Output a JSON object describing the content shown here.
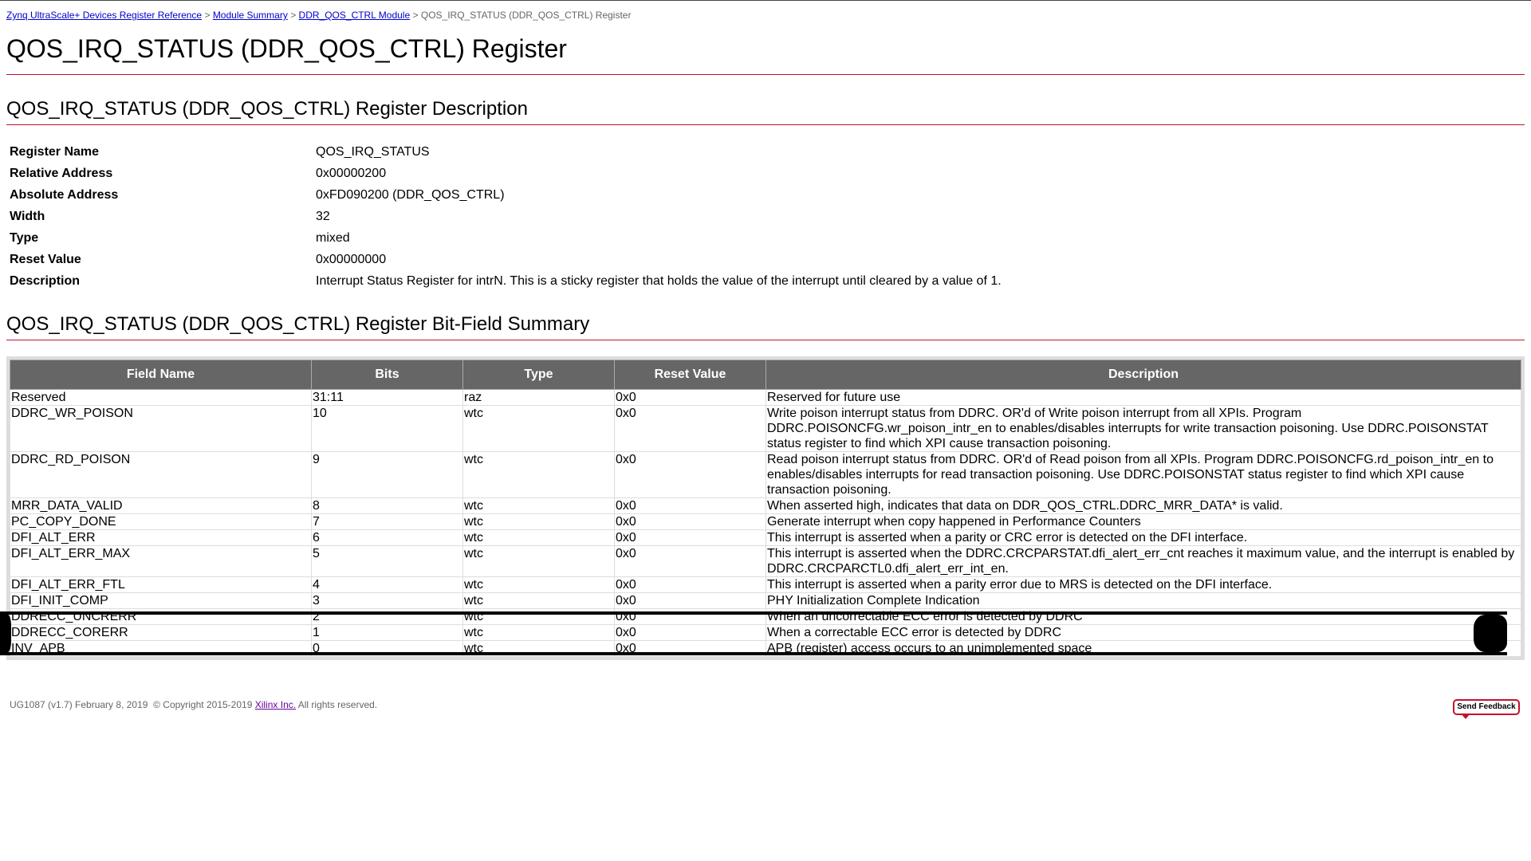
{
  "breadcrumb": {
    "items": [
      {
        "label": "Zynq UltraScale+ Devices Register Reference"
      },
      {
        "label": "Module Summary"
      },
      {
        "label": "DDR_QOS_CTRL Module"
      }
    ],
    "current": "QOS_IRQ_STATUS (DDR_QOS_CTRL) Register",
    "separator": ">"
  },
  "page_title": "QOS_IRQ_STATUS (DDR_QOS_CTRL) Register",
  "description_section": {
    "heading": "QOS_IRQ_STATUS (DDR_QOS_CTRL) Register Description",
    "rows": [
      {
        "key": "Register Name",
        "value": "QOS_IRQ_STATUS"
      },
      {
        "key": "Relative Address",
        "value": "0x00000200"
      },
      {
        "key": "Absolute Address",
        "value": "0xFD090200 (DDR_QOS_CTRL)"
      },
      {
        "key": "Width",
        "value": "32"
      },
      {
        "key": "Type",
        "value": "mixed"
      },
      {
        "key": "Reset Value",
        "value": "0x00000000"
      },
      {
        "key": "Description",
        "value": "Interrupt Status Register for intrN. This is a sticky register that holds the value of the interrupt until cleared by a value of 1."
      }
    ]
  },
  "bitfield_section": {
    "heading": "QOS_IRQ_STATUS (DDR_QOS_CTRL) Register Bit-Field Summary",
    "columns": [
      "Field Name",
      "Bits",
      "Type",
      "Reset Value",
      "Description"
    ],
    "rows": [
      {
        "name": "Reserved",
        "bits": "31:11",
        "type": "raz",
        "reset": "0x0",
        "desc": "Reserved for future use"
      },
      {
        "name": "DDRC_WR_POISON",
        "bits": "10",
        "type": "wtc",
        "reset": "0x0",
        "desc": "Write poison interrupt status from DDRC. OR'd of Write poison interrupt from all XPIs. Program DDRC.POISONCFG.wr_poison_intr_en to enables/disables interrupts for write transaction poisoning. Use DDRC.POISONSTAT status register to find which XPI cause transaction poisoning."
      },
      {
        "name": "DDRC_RD_POISON",
        "bits": "9",
        "type": "wtc",
        "reset": "0x0",
        "desc": "Read poison interrupt status from DDRC. OR'd of Read poison from all XPIs. Program DDRC.POISONCFG.rd_poison_intr_en to enables/disables interrupts for read transaction poisoning. Use DDRC.POISONSTAT status register to find which XPI cause transaction poisoning."
      },
      {
        "name": "MRR_DATA_VALID",
        "bits": "8",
        "type": "wtc",
        "reset": "0x0",
        "desc": "When asserted high, indicates that data on DDR_QOS_CTRL.DDRC_MRR_DATA* is valid."
      },
      {
        "name": "PC_COPY_DONE",
        "bits": "7",
        "type": "wtc",
        "reset": "0x0",
        "desc": "Generate interrupt when copy happened in Performance Counters"
      },
      {
        "name": "DFI_ALT_ERR",
        "bits": "6",
        "type": "wtc",
        "reset": "0x0",
        "desc": "This interrupt is asserted when a parity or CRC error is detected on the DFI interface."
      },
      {
        "name": "DFI_ALT_ERR_MAX",
        "bits": "5",
        "type": "wtc",
        "reset": "0x0",
        "desc": "This interrupt is asserted when the DDRC.CRCPARSTAT.dfi_alert_err_cnt reaches it maximum value, and the interrupt is enabled by DDRC.CRCPARCTL0.dfi_alert_err_int_en."
      },
      {
        "name": "DFI_ALT_ERR_FTL",
        "bits": "4",
        "type": "wtc",
        "reset": "0x0",
        "desc": "This interrupt is asserted when a parity error due to MRS is detected on the DFI interface."
      },
      {
        "name": "DFI_INIT_COMP",
        "bits": "3",
        "type": "wtc",
        "reset": "0x0",
        "desc": "PHY Initialization Complete Indication"
      },
      {
        "name": "DDRECC_UNCRERR",
        "bits": "2",
        "type": "wtc",
        "reset": "0x0",
        "desc": "When an uncorrectable ECC error is detected by DDRC"
      },
      {
        "name": "DDRECC_CORERR",
        "bits": "1",
        "type": "wtc",
        "reset": "0x0",
        "desc": "When a correctable ECC error is detected by DDRC"
      },
      {
        "name": "INV_APB",
        "bits": "0",
        "type": "wtc",
        "reset": "0x0",
        "desc": "APB (register) access occurs to an unimplemented space"
      }
    ]
  },
  "footer": {
    "doc": "UG1087 (v1.7) February 8, 2019",
    "copyright": "© Copyright 2015-2019",
    "company_link": "Xilinx Inc.",
    "rights": "All rights reserved."
  },
  "feedback_button": {
    "label": "Send Feedback"
  },
  "colors": {
    "accent": "#c41230",
    "header_bg": "#666666",
    "link": "#0000cc"
  }
}
